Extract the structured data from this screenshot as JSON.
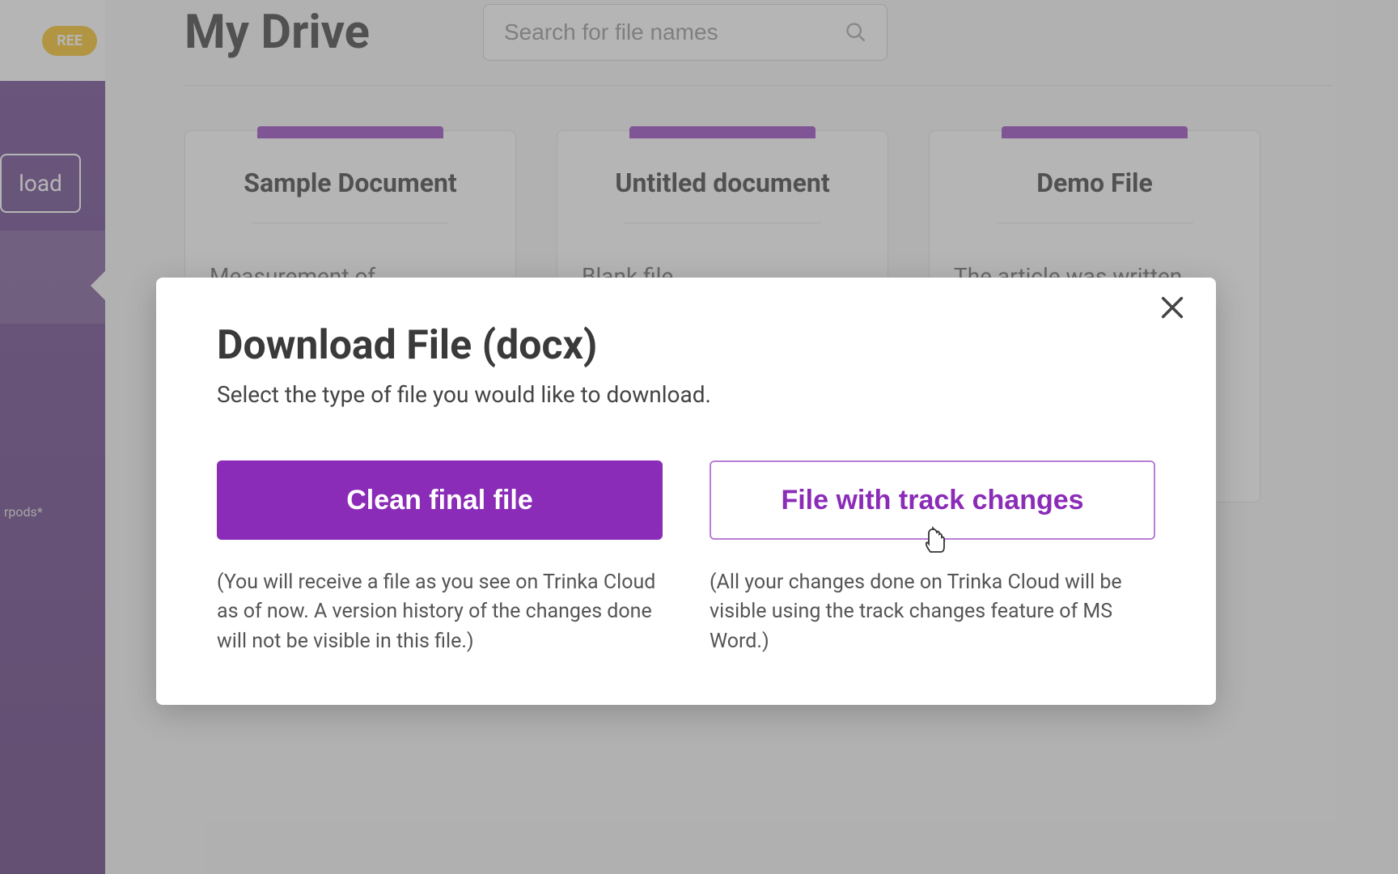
{
  "sidebar": {
    "badge": "REE",
    "upload_button": "load",
    "small_text": "rpods*"
  },
  "header": {
    "title": "My Drive",
    "search_placeholder": "Search for file names"
  },
  "cards": [
    {
      "title": "Sample Document",
      "preview": "Measurement of"
    },
    {
      "title": "Untitled document",
      "preview": "Blank file"
    },
    {
      "title": "Demo File",
      "preview": "The article was written"
    }
  ],
  "modal": {
    "title": "Download File (docx)",
    "subtitle": "Select the type of file you would like to download.",
    "options": [
      {
        "label": "Clean final file",
        "description": "(You will receive a file as you see on Trinka Cloud as of now. A version history of the changes done will not be visible in this file.)"
      },
      {
        "label": "File with track changes",
        "description": "(All your changes done on Trinka Cloud will be visible using the track changes feature of MS Word.)"
      }
    ]
  }
}
